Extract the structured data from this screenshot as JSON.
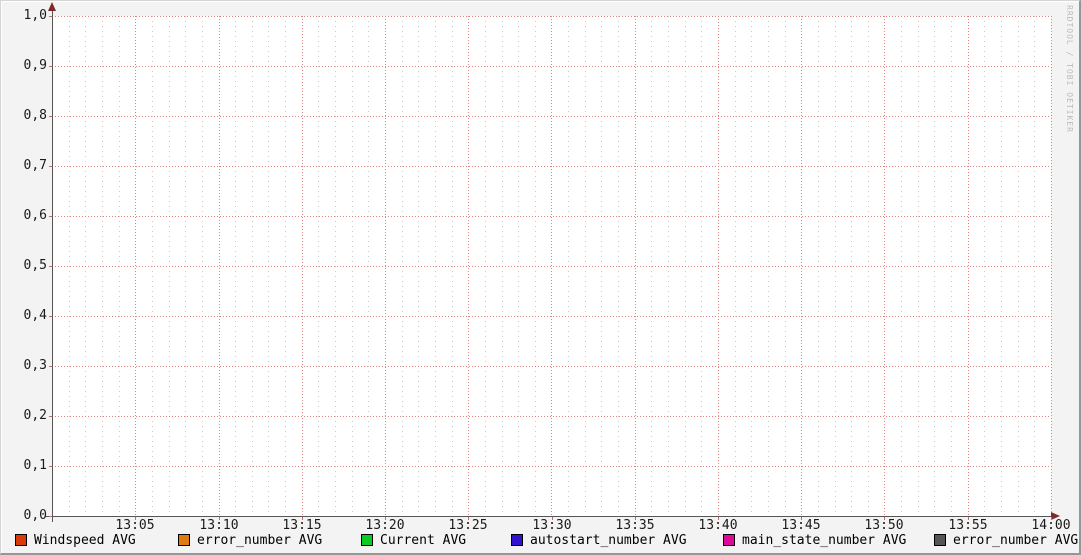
{
  "watermark": "RRDTOOL / TOBI OETIKER",
  "axes": {
    "y_ticks": [
      "1,0",
      "0,9",
      "0,8",
      "0,7",
      "0,6",
      "0,5",
      "0,4",
      "0,3",
      "0,2",
      "0,1",
      "0,0"
    ],
    "x_ticks": [
      "13:05",
      "13:10",
      "13:15",
      "13:20",
      "13:25",
      "13:30",
      "13:35",
      "13:40",
      "13:45",
      "13:50",
      "13:55",
      "14:00"
    ]
  },
  "legend": {
    "items": [
      {
        "label": "Windspeed AVG",
        "color": "#d93a0a"
      },
      {
        "label": "error_number AVG",
        "color": "#e07b10"
      },
      {
        "label": "Current AVG",
        "color": "#0acc22"
      },
      {
        "label": "autostart_number AVG",
        "color": "#3311d1"
      },
      {
        "label": "main_state_number AVG",
        "color": "#dd0a9c"
      },
      {
        "label": "error_number AVG",
        "color": "#555555"
      }
    ]
  },
  "chart_data": {
    "type": "line",
    "title": "",
    "xlabel": "",
    "ylabel": "",
    "x_range": [
      "13:00",
      "14:00"
    ],
    "x_tick_labels": [
      "13:05",
      "13:10",
      "13:15",
      "13:20",
      "13:25",
      "13:30",
      "13:35",
      "13:40",
      "13:45",
      "13:50",
      "13:55",
      "14:00"
    ],
    "x_minor_step_minutes": 1,
    "x_major_step_minutes": 5,
    "ylim": [
      0.0,
      1.0
    ],
    "y_tick_labels": [
      "0,0",
      "0,1",
      "0,2",
      "0,3",
      "0,4",
      "0,5",
      "0,6",
      "0,7",
      "0,8",
      "0,9",
      "1,0"
    ],
    "y_major_step": 0.1,
    "decimal_separator": ",",
    "grid": {
      "visible": true,
      "style": "dotted",
      "major_color": "#dc8383",
      "minor_color": "#c9c9c9"
    },
    "legend_position": "bottom",
    "series": [
      {
        "name": "Windspeed AVG",
        "color": "#d93a0a",
        "values": []
      },
      {
        "name": "error_number AVG",
        "color": "#e07b10",
        "values": []
      },
      {
        "name": "Current AVG",
        "color": "#0acc22",
        "values": []
      },
      {
        "name": "autostart_number AVG",
        "color": "#3311d1",
        "values": []
      },
      {
        "name": "main_state_number AVG",
        "color": "#dd0a9c",
        "values": []
      },
      {
        "name": "error_number AVG",
        "color": "#555555",
        "values": []
      }
    ],
    "note": "no data points plotted; graph canvas is empty"
  }
}
